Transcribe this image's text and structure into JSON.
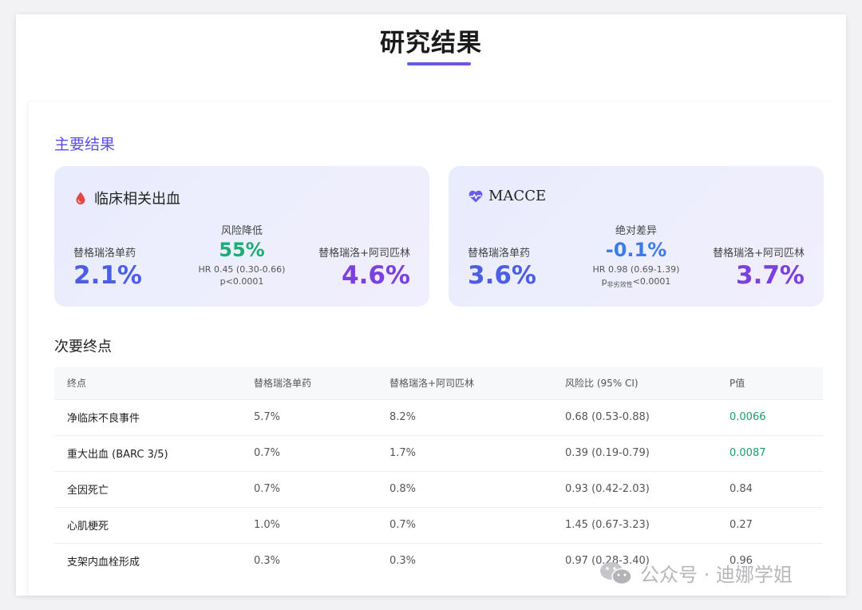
{
  "header": {
    "title": "研究结果"
  },
  "primary": {
    "heading": "主要结果",
    "cards": [
      {
        "title": "临床相关出血",
        "icon": "blood-drop-icon",
        "left": {
          "label": "替格瑞洛单药",
          "value": "2.1%"
        },
        "mid": {
          "label": "风险降低",
          "value": "55%",
          "hr": "HR 0.45 (0.30-0.66)",
          "p": "p<0.0001",
          "p_sub": ""
        },
        "right": {
          "label": "替格瑞洛+阿司匹林",
          "value": "4.6%"
        }
      },
      {
        "title": "MACCE",
        "icon": "heartbeat-icon",
        "left": {
          "label": "替格瑞洛单药",
          "value": "3.6%"
        },
        "mid": {
          "label": "绝对差异",
          "value": "-0.1%",
          "hr": "HR 0.98 (0.69-1.39)",
          "p_main": "p",
          "p_sub": "非劣效性",
          "p_rest": "<0.0001"
        },
        "right": {
          "label": "替格瑞洛+阿司匹林",
          "value": "3.7%"
        }
      }
    ]
  },
  "secondary": {
    "heading": "次要终点",
    "columns": [
      "终点",
      "替格瑞洛单药",
      "替格瑞洛+阿司匹林",
      "风险比 (95% CI)",
      "P值"
    ],
    "rows": [
      [
        "净临床不良事件",
        "5.7%",
        "8.2%",
        "0.68 (0.53-0.88)",
        "0.0066"
      ],
      [
        "重大出血 (BARC 3/5)",
        "0.7%",
        "1.7%",
        "0.39 (0.19-0.79)",
        "0.0087"
      ],
      [
        "全因死亡",
        "0.7%",
        "0.8%",
        "0.93 (0.42-2.03)",
        "0.84"
      ],
      [
        "心肌梗死",
        "1.0%",
        "0.7%",
        "1.45 (0.67-3.23)",
        "0.27"
      ],
      [
        "支架内血栓形成",
        "0.3%",
        "0.3%",
        "0.97 (0.28-3.40)",
        "0.96"
      ]
    ]
  },
  "colors": {
    "accent_blue": "#4b5fe6",
    "accent_purple": "#7c3fe0",
    "significant_green": "#1a9e6a",
    "drop_red": "#e84545"
  },
  "watermark": {
    "text": "公众号 · 迪娜学姐",
    "icon": "wechat-icon"
  }
}
